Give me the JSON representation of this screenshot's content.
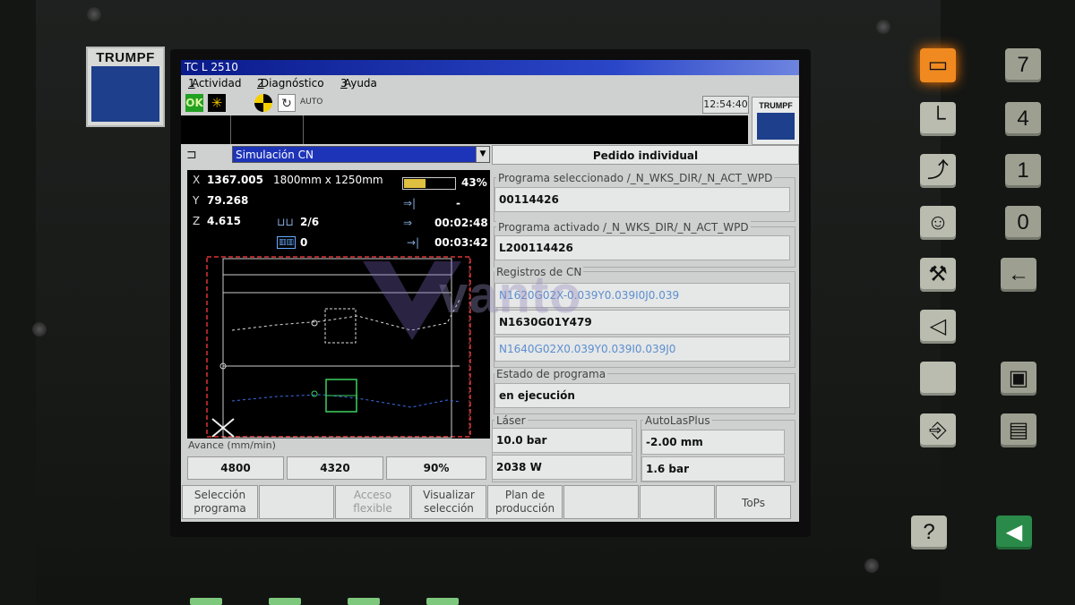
{
  "brand": {
    "logo_text": "TRUMPF"
  },
  "window": {
    "title": "TC L 2510"
  },
  "menu": [
    {
      "num": "1",
      "label": "Actividad"
    },
    {
      "num": "2",
      "label": "Diagnóstico"
    },
    {
      "num": "3",
      "label": "Ayuda"
    }
  ],
  "status": {
    "ok_label": "OK",
    "auto_label": "AUTO",
    "clock": "12:54:40",
    "mini_logo": "TRUMPF"
  },
  "mode_select": {
    "value": "Simulación CN"
  },
  "order": {
    "label": "Pedido individual"
  },
  "position": {
    "x_label": "X",
    "x_value": "1367.005",
    "y_label": "Y",
    "y_value": "79.268",
    "z_label": "Z",
    "z_value": "4.615",
    "sheet_size": "1800mm x 1250mm",
    "progress_percent": 43,
    "progress_label": "43%",
    "parts_label": "2/6",
    "count_label": "0",
    "time_next": "-",
    "time_elapsed": "00:02:48",
    "time_remaining": "00:03:42"
  },
  "feed": {
    "label": "Avance (mm/min)",
    "values": [
      "4800",
      "4320",
      "90%"
    ]
  },
  "program": {
    "selected_label": "Programa seleccionado /_N_WKS_DIR/_N_ACT_WPD",
    "selected_value": "00114426",
    "activated_label": "Programa activado /_N_WKS_DIR/_N_ACT_WPD",
    "activated_value": "L200114426",
    "cn_label": "Registros de CN",
    "cn_lines": [
      "N1620G02X-0.039Y0.039I0J0.039",
      "N1630G01Y479",
      "N1640G02X0.039Y0.039I0.039J0"
    ],
    "state_label": "Estado de programa",
    "state_value": "en ejecución"
  },
  "laser": {
    "label": "Láser",
    "pressure": "10.0 bar",
    "power": "2038 W"
  },
  "autolas": {
    "label": "AutoLasPlus",
    "distance": "-2.00 mm",
    "pressure": "1.6 bar"
  },
  "softkeys": [
    {
      "line1": "Selección",
      "line2": "programa",
      "enabled": true
    },
    {
      "line1": "",
      "line2": "",
      "enabled": true
    },
    {
      "line1": "Acceso",
      "line2": "flexible",
      "enabled": false
    },
    {
      "line1": "Visualizar",
      "line2": "selección",
      "enabled": true
    },
    {
      "line1": "Plan de",
      "line2": "producción",
      "enabled": true
    },
    {
      "line1": "",
      "line2": "",
      "enabled": true
    },
    {
      "line1": "",
      "line2": "",
      "enabled": true
    },
    {
      "line1": "ToPs",
      "line2": "",
      "enabled": true
    }
  ],
  "keypad": {
    "digits": [
      "7",
      "4",
      "1",
      "0"
    ],
    "icons": [
      "program-start-icon",
      "axis-icon",
      "jog-icon",
      "person-icon",
      "wrench-icon",
      "speaker-icon",
      "blank-key",
      "door-icon",
      "question-icon"
    ]
  },
  "watermark": "vanto",
  "colors": {
    "title_bar": "#1e34b8",
    "accent_orange": "#f08a20",
    "brand_blue": "#1d3f8c"
  }
}
